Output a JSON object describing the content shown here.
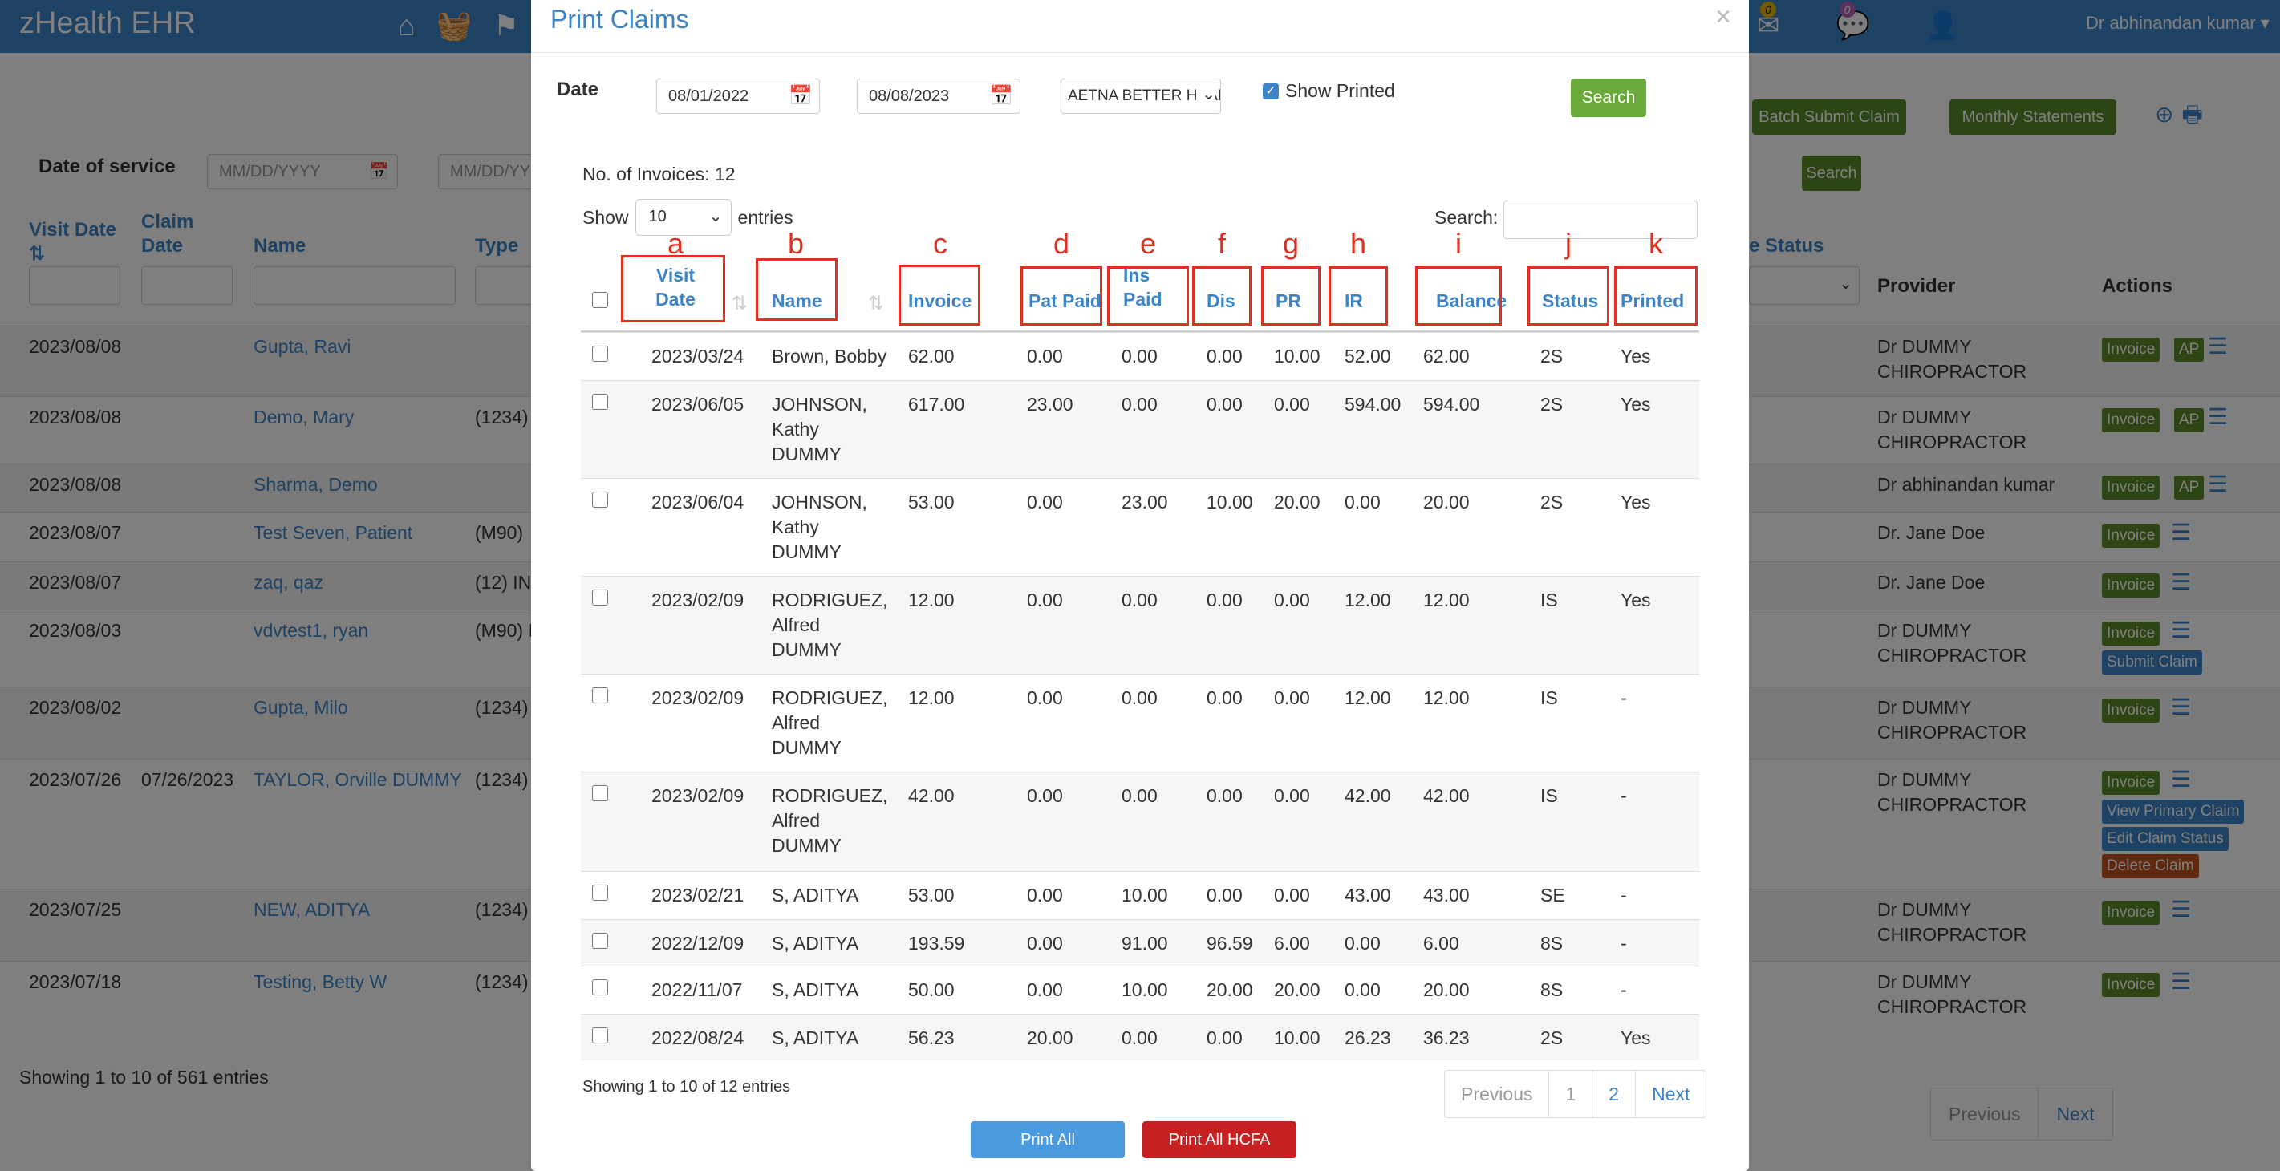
{
  "app": {
    "title": "zHealth EHR",
    "user": "Dr abhinandan kumar",
    "nav_icons": [
      "home-icon",
      "basket-icon",
      "flag-icon"
    ],
    "notification_counts": [
      "0",
      "0"
    ]
  },
  "background": {
    "batch_submit_label": "Batch Submit Claim",
    "monthly_statements_label": "Monthly Statements",
    "search_label": "Search",
    "date_of_service_label": "Date of service",
    "date_placeholder_from": "MM/DD/YYYY",
    "date_placeholder_to": "MM/DD/YY",
    "headers": {
      "visit_date": "Visit Date",
      "claim_date": "Claim Date",
      "name": "Name",
      "type": "Type",
      "status": "e Status",
      "provider": "Provider",
      "actions": "Actions"
    },
    "rows": [
      {
        "visit": "2023/08/08",
        "claim": "",
        "name": "Gupta, Ravi",
        "type": "",
        "provider": "Dr DUMMY CHIROPRACTOR"
      },
      {
        "visit": "2023/08/08",
        "claim": "",
        "name": "Demo, Mary",
        "type": "(1234)",
        "provider": "Dr DUMMY CHIROPRACTOR"
      },
      {
        "visit": "2023/08/08",
        "claim": "",
        "name": "Sharma, Demo",
        "type": "",
        "provider": "Dr abhinandan kumar"
      },
      {
        "visit": "2023/08/07",
        "claim": "",
        "name": "Test Seven, Patient",
        "type": "(M90)",
        "provider": "Dr. Jane Doe"
      },
      {
        "visit": "2023/08/07",
        "claim": "",
        "name": "zaq, qaz",
        "type": "(12) IN",
        "provider": "Dr. Jane Doe"
      },
      {
        "visit": "2023/08/03",
        "claim": "",
        "name": "vdvtest1, ryan",
        "type": "(M90) I",
        "provider": "Dr DUMMY CHIROPRACTOR"
      },
      {
        "visit": "2023/08/02",
        "claim": "",
        "name": "Gupta, Milo",
        "type": "(1234)",
        "provider": "Dr DUMMY CHIROPRACTOR"
      },
      {
        "visit": "2023/07/26",
        "claim": "07/26/2023",
        "name": "TAYLOR, Orville DUMMY",
        "type": "(1234)",
        "provider": "Dr DUMMY CHIROPRACTOR"
      },
      {
        "visit": "2023/07/25",
        "claim": "",
        "name": "NEW, ADITYA",
        "type": "(1234)",
        "provider": "Dr DUMMY CHIROPRACTOR"
      },
      {
        "visit": "2023/07/18",
        "claim": "",
        "name": "Testing, Betty W",
        "type": "(1234)",
        "provider": "Dr DUMMY CHIROPRACTOR"
      }
    ],
    "action_labels": {
      "invoice": "Invoice",
      "ap": "AP",
      "submit_claim": "Submit Claim",
      "view_primary": "View Primary Claim",
      "edit_status": "Edit Claim Status",
      "delete_claim": "Delete Claim"
    },
    "footer": "Showing 1 to 10 of 561 entries",
    "pager": [
      "Previous",
      "Next"
    ]
  },
  "modal": {
    "title": "Print Claims",
    "close": "×",
    "date_label": "Date",
    "date_from": "08/01/2022",
    "date_to": "08/08/2023",
    "insurance": "AETNA BETTER HEALTH",
    "show_printed_label": "Show Printed",
    "show_printed": true,
    "search_label": "Search",
    "invoice_count": "No. of Invoices: 12",
    "show_label": "Show",
    "entries_value": "10",
    "entries_label": "entries",
    "search_box_label": "Search:",
    "columns": {
      "visit_date": "Visit Date",
      "name": "Name",
      "invoice": "Invoice",
      "pat_paid": "Pat Paid",
      "ins_paid": "Ins Paid",
      "dis": "Dis",
      "pr": "PR",
      "ir": "IR",
      "balance": "Balance",
      "status": "Status",
      "printed": "Printed"
    },
    "annotation_letters": [
      "a",
      "b",
      "c",
      "d",
      "e",
      "f",
      "g",
      "h",
      "i",
      "j",
      "k"
    ],
    "rows": [
      {
        "visit": "2023/03/24",
        "name": [
          "Brown, Bobby"
        ],
        "invoice": "62.00",
        "pat": "0.00",
        "ins": "0.00",
        "dis": "0.00",
        "pr": "10.00",
        "ir": "52.00",
        "bal": "62.00",
        "status": "2S",
        "printed": "Yes"
      },
      {
        "visit": "2023/06/05",
        "name": [
          "JOHNSON,",
          "Kathy",
          "DUMMY"
        ],
        "invoice": "617.00",
        "pat": "23.00",
        "ins": "0.00",
        "dis": "0.00",
        "pr": "0.00",
        "ir": "594.00",
        "bal": "594.00",
        "status": "2S",
        "printed": "Yes"
      },
      {
        "visit": "2023/06/04",
        "name": [
          "JOHNSON,",
          "Kathy",
          "DUMMY"
        ],
        "invoice": "53.00",
        "pat": "0.00",
        "ins": "23.00",
        "dis": "10.00",
        "pr": "20.00",
        "ir": "0.00",
        "bal": "20.00",
        "status": "2S",
        "printed": "Yes"
      },
      {
        "visit": "2023/02/09",
        "name": [
          "RODRIGUEZ,",
          "Alfred",
          "DUMMY"
        ],
        "invoice": "12.00",
        "pat": "0.00",
        "ins": "0.00",
        "dis": "0.00",
        "pr": "0.00",
        "ir": "12.00",
        "bal": "12.00",
        "status": "IS",
        "printed": "Yes"
      },
      {
        "visit": "2023/02/09",
        "name": [
          "RODRIGUEZ,",
          "Alfred",
          "DUMMY"
        ],
        "invoice": "12.00",
        "pat": "0.00",
        "ins": "0.00",
        "dis": "0.00",
        "pr": "0.00",
        "ir": "12.00",
        "bal": "12.00",
        "status": "IS",
        "printed": "-"
      },
      {
        "visit": "2023/02/09",
        "name": [
          "RODRIGUEZ,",
          "Alfred",
          "DUMMY"
        ],
        "invoice": "42.00",
        "pat": "0.00",
        "ins": "0.00",
        "dis": "0.00",
        "pr": "0.00",
        "ir": "42.00",
        "bal": "42.00",
        "status": "IS",
        "printed": "-"
      },
      {
        "visit": "2023/02/21",
        "name": [
          "S, ADITYA"
        ],
        "invoice": "53.00",
        "pat": "0.00",
        "ins": "10.00",
        "dis": "0.00",
        "pr": "0.00",
        "ir": "43.00",
        "bal": "43.00",
        "status": "SE",
        "printed": "-"
      },
      {
        "visit": "2022/12/09",
        "name": [
          "S, ADITYA"
        ],
        "invoice": "193.59",
        "pat": "0.00",
        "ins": "91.00",
        "dis": "96.59",
        "pr": "6.00",
        "ir": "0.00",
        "bal": "6.00",
        "status": "8S",
        "printed": "-"
      },
      {
        "visit": "2022/11/07",
        "name": [
          "S, ADITYA"
        ],
        "invoice": "50.00",
        "pat": "0.00",
        "ins": "10.00",
        "dis": "20.00",
        "pr": "20.00",
        "ir": "0.00",
        "bal": "20.00",
        "status": "8S",
        "printed": "-"
      },
      {
        "visit": "2022/08/24",
        "name": [
          "S, ADITYA"
        ],
        "invoice": "56.23",
        "pat": "20.00",
        "ins": "0.00",
        "dis": "0.00",
        "pr": "10.00",
        "ir": "26.23",
        "bal": "36.23",
        "status": "2S",
        "printed": "Yes"
      }
    ],
    "footer": "Showing 1 to 10 of 12 entries",
    "pager": [
      "Previous",
      "1",
      "2",
      "Next"
    ],
    "print_all_label": "Print All",
    "print_hcfa_label": "Print All HCFA"
  }
}
